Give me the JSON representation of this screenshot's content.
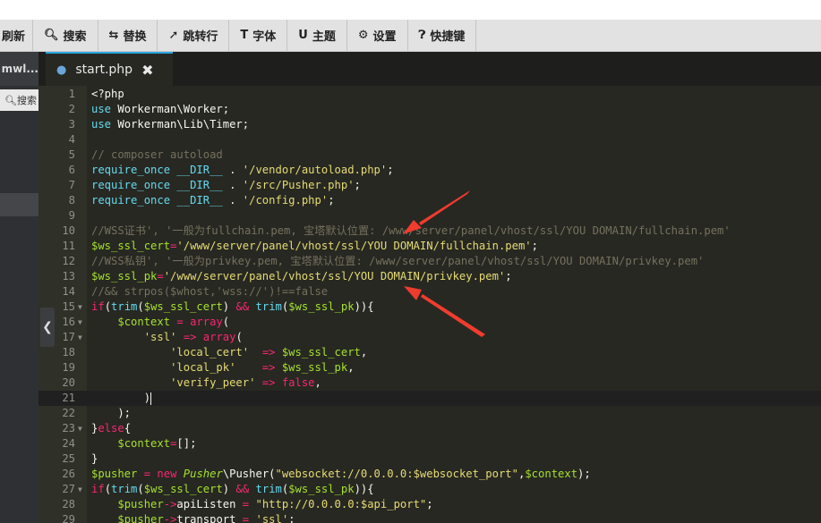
{
  "toolbar": {
    "refresh_label": "刷新",
    "search_label": "搜索",
    "replace_label": "替换",
    "goto_label": "跳转行",
    "font_label": "字体",
    "theme_label": "主题",
    "settings_label": "设置",
    "shortcuts_label": "快捷键"
  },
  "sidebar": {
    "tab_label": "mwl...",
    "search_label": "搜索"
  },
  "editor_tab": {
    "filename": "start.php",
    "close": "✖"
  },
  "code_lines": [
    {
      "n": "1",
      "text": "<?php"
    },
    {
      "n": "2",
      "text": "use Workerman\\Worker;"
    },
    {
      "n": "3",
      "text": "use Workerman\\Lib\\Timer;"
    },
    {
      "n": "4",
      "text": ""
    },
    {
      "n": "5",
      "text": "// composer autoload"
    },
    {
      "n": "6",
      "text": "require_once __DIR__ . '/vendor/autoload.php';"
    },
    {
      "n": "7",
      "text": "require_once __DIR__ . '/src/Pusher.php';"
    },
    {
      "n": "8",
      "text": "require_once __DIR__ . '/config.php';"
    },
    {
      "n": "9",
      "text": ""
    },
    {
      "n": "10",
      "text": "//WSS证书', '一般为fullchain.pem, 宝塔默认位置: /www/server/panel/vhost/ssl/YOU DOMAIN/fullchain.pem'"
    },
    {
      "n": "11",
      "text": "$ws_ssl_cert='/www/server/panel/vhost/ssl/YOU DOMAIN/fullchain.pem';"
    },
    {
      "n": "12",
      "text": "//WSS私钥', '一般为privkey.pem, 宝塔默认位置: /www/server/panel/vhost/ssl/YOU DOMAIN/privkey.pem'"
    },
    {
      "n": "13",
      "text": "$ws_ssl_pk='/www/server/panel/vhost/ssl/YOU DOMAIN/privkey.pem';"
    },
    {
      "n": "14",
      "text": "//&& strpos($whost,'wss://')!==false"
    },
    {
      "n": "15",
      "text": "if(trim($ws_ssl_cert) && trim($ws_ssl_pk)){"
    },
    {
      "n": "16",
      "text": "    $context = array("
    },
    {
      "n": "17",
      "text": "        'ssl' => array("
    },
    {
      "n": "18",
      "text": "            'local_cert'  => $ws_ssl_cert,"
    },
    {
      "n": "19",
      "text": "            'local_pk'    => $ws_ssl_pk,"
    },
    {
      "n": "20",
      "text": "            'verify_peer' => false,"
    },
    {
      "n": "21",
      "text": "        )"
    },
    {
      "n": "22",
      "text": "    );"
    },
    {
      "n": "23",
      "text": "}else{"
    },
    {
      "n": "24",
      "text": "    $context=[];"
    },
    {
      "n": "25",
      "text": "}"
    },
    {
      "n": "26",
      "text": "$pusher = new Pusher\\Pusher(\"websocket://0.0.0.0:$websocket_port\",$context);"
    },
    {
      "n": "27",
      "text": "if(trim($ws_ssl_cert) && trim($ws_ssl_pk)){"
    },
    {
      "n": "28",
      "text": "    $pusher->apiListen = \"http://0.0.0.0:$api_port\";"
    },
    {
      "n": "29",
      "text": "    $pusher->transport = 'ssl';"
    }
  ],
  "colors": {
    "editor_bg": "#272822",
    "keyword": "#66d9ef",
    "operator": "#f92672",
    "string": "#e6db74",
    "variable": "#a6e22e",
    "comment": "#75715e",
    "tab_accent": "#2aa4e0",
    "arrow": "#f03c2e"
  },
  "icons": [
    "search-icon",
    "replace-icon",
    "goto-icon",
    "font-icon",
    "theme-icon",
    "gear-icon",
    "help-icon",
    "elephant-icon",
    "close-icon",
    "chevron-left-icon"
  ]
}
